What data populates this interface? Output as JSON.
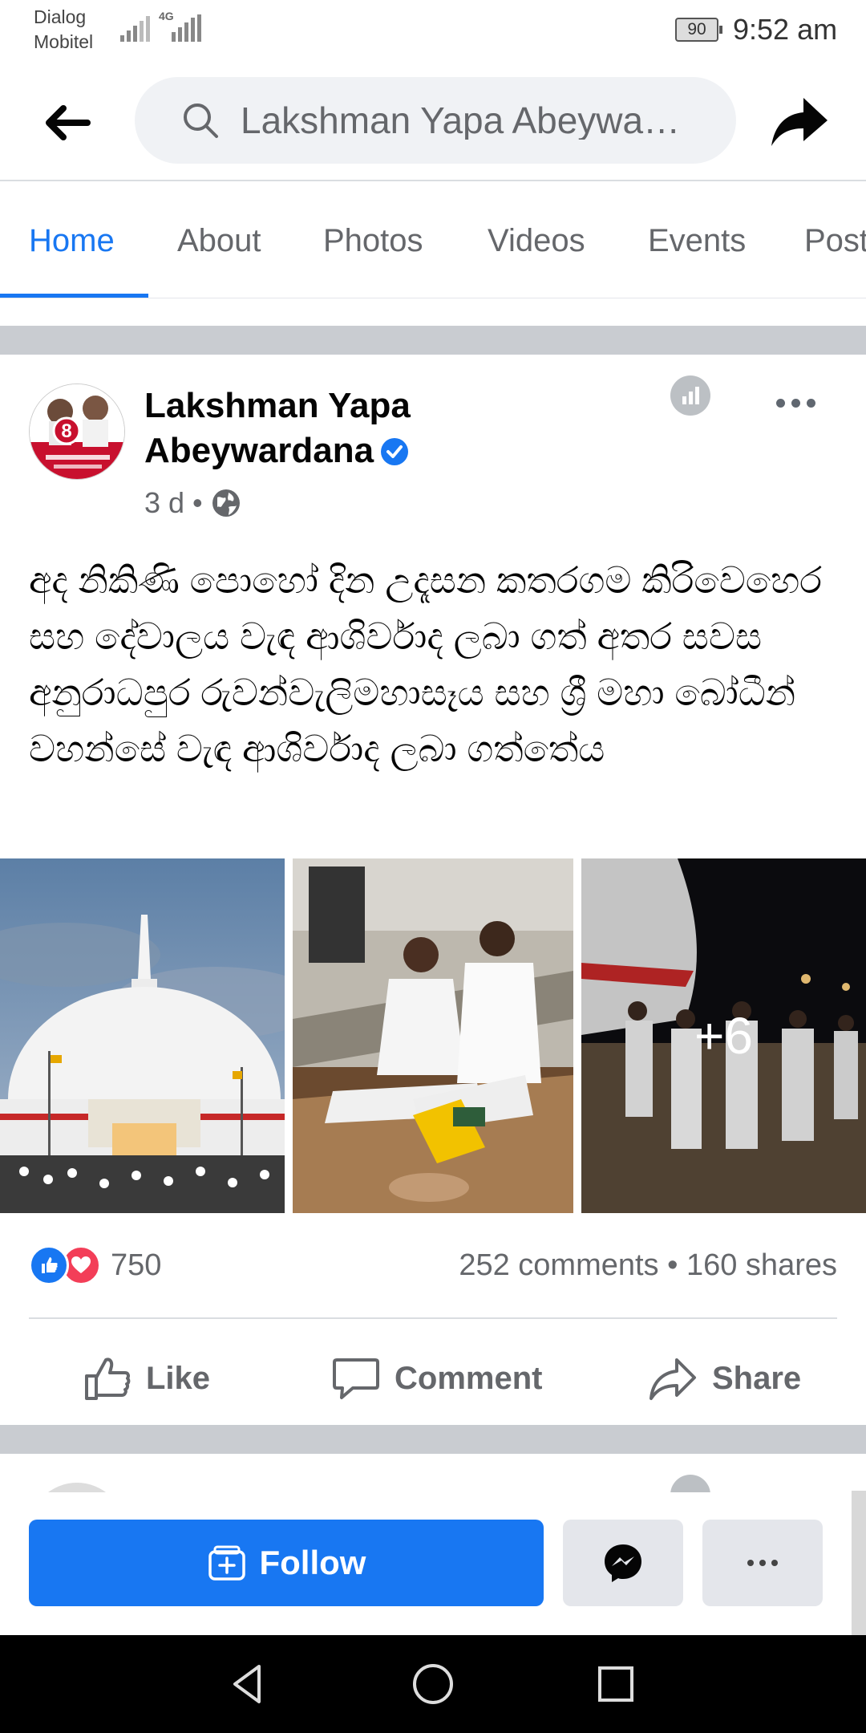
{
  "status_bar": {
    "carrier_line1": "Dialog",
    "carrier_line2": "Mobitel",
    "network": "4G",
    "battery": "90",
    "time": "9:52 am"
  },
  "header": {
    "search_text": "Lakshman Yapa Abeywa…"
  },
  "tabs": [
    "Home",
    "About",
    "Photos",
    "Videos",
    "Events",
    "Posts"
  ],
  "active_tab": "Home",
  "post": {
    "author": "Lakshman Yapa Abeywardana",
    "time": "3 d",
    "separator": "•",
    "text": "අද නිකිණි පොහෝ දින උදෑසන කතරගම කිරිවෙහෙර සහ දේවාලය වැඳ ආශිර්වාද ලබා ගත් අතර සවස අනුරාධපුර රුවන්වැලිමහාසෑය සහ ශ්‍රී මහා බෝධීන් වහන්සේ වැඳ ආශිර්වාද ලබා ගත්තේය",
    "more_photos": "+6",
    "reaction_count": "750",
    "engagement": "252 comments • 160 shares",
    "actions": {
      "like": "Like",
      "comment": "Comment",
      "share": "Share"
    }
  },
  "bottom_bar": {
    "follow": "Follow"
  },
  "colors": {
    "accent": "#1877f2",
    "love": "#f33e58",
    "secondary_text": "#65676b",
    "button_gray": "#e4e6eb"
  },
  "icons": [
    "back-arrow-icon",
    "search-icon",
    "share-arrow-icon",
    "verified-icon",
    "globe-icon",
    "insights-icon",
    "more-dots-icon",
    "like-icon",
    "love-icon",
    "thumbs-up-icon",
    "comment-icon",
    "share-icon",
    "follow-icon",
    "messenger-icon",
    "nav-back-icon",
    "nav-home-icon",
    "nav-recents-icon"
  ]
}
